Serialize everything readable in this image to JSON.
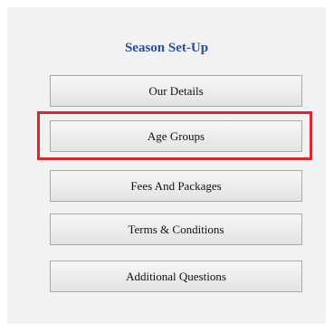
{
  "panel": {
    "title": "Season Set-Up",
    "buttons": [
      {
        "label": "Our Details"
      },
      {
        "label": "Age Groups"
      },
      {
        "label": "Fees And Packages"
      },
      {
        "label": "Terms & Conditions"
      },
      {
        "label": "Additional Questions"
      }
    ]
  },
  "colors": {
    "title": "#2a4f9a",
    "highlight": "#e0252c",
    "panel_background": "#f2f2f2",
    "button_border": "#a9a9a9"
  },
  "highlighted_button": "Age Groups"
}
